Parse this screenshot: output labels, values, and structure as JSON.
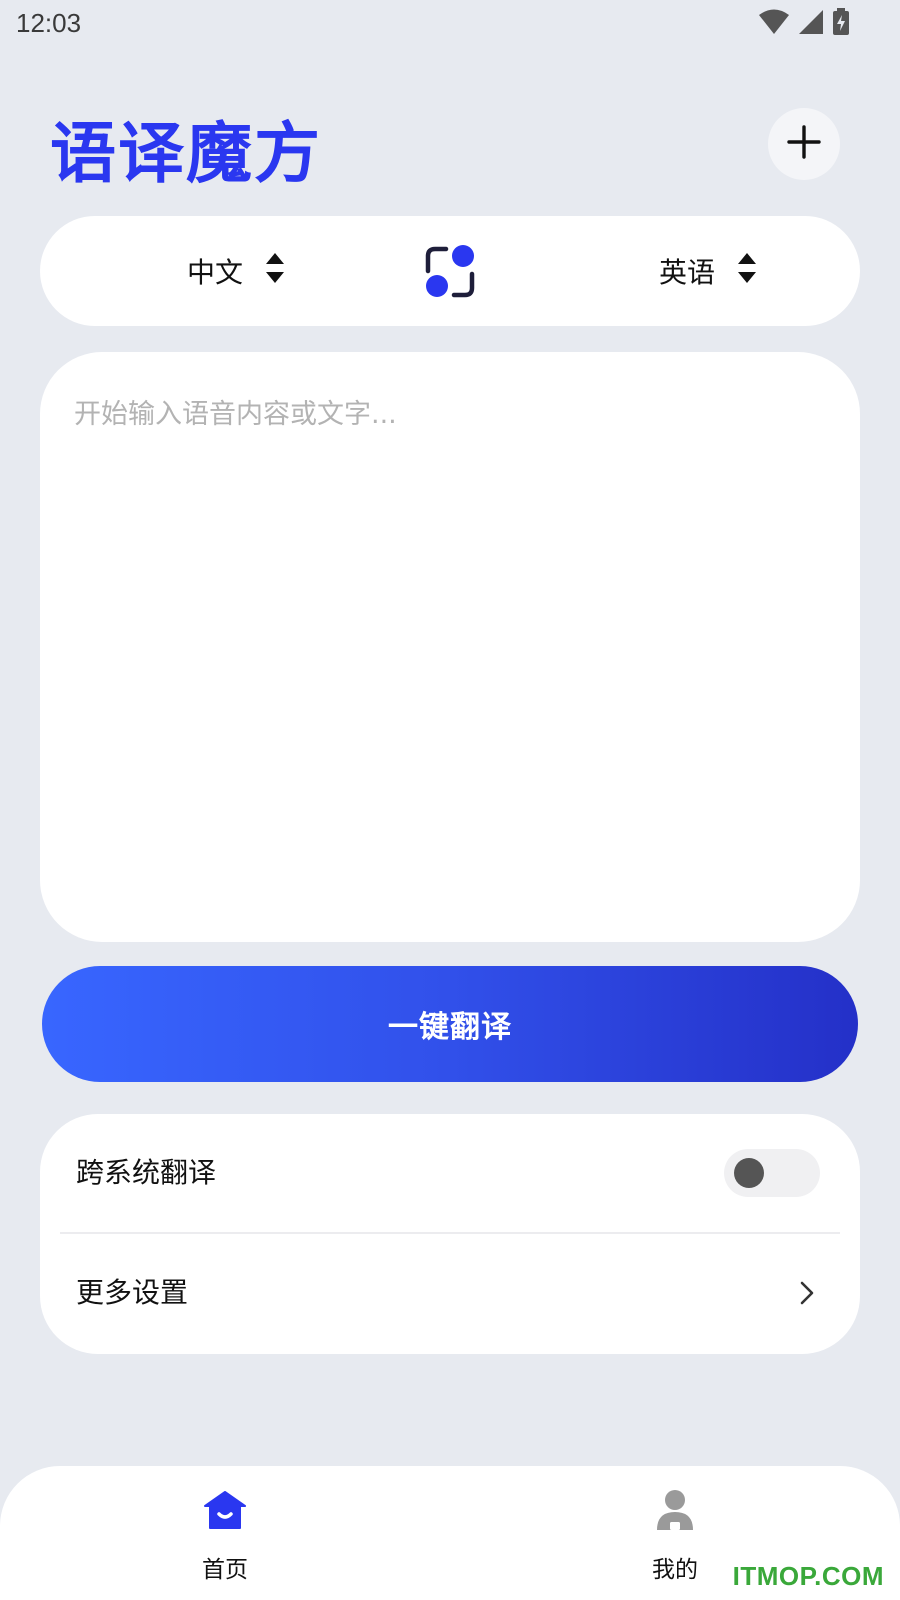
{
  "status_bar": {
    "time": "12:03",
    "icons": [
      "wifi-icon",
      "signal-icon",
      "battery-charging-icon"
    ]
  },
  "header": {
    "title": "语译魔方",
    "add_icon": "plus-icon"
  },
  "language_bar": {
    "source_language": "中文",
    "target_language": "英语",
    "swap_icon": "swap-languages-icon"
  },
  "input": {
    "value": "",
    "placeholder": "开始输入语音内容或文字..."
  },
  "actions": {
    "translate_label": "一键翻译"
  },
  "settings": {
    "items": [
      {
        "label": "跨系统翻译",
        "control": "toggle",
        "enabled": false
      },
      {
        "label": "更多设置",
        "control": "chevron-right-icon"
      }
    ]
  },
  "bottom_nav": {
    "items": [
      {
        "label": "首页",
        "icon": "home-icon",
        "active": true
      },
      {
        "label": "我的",
        "icon": "user-icon",
        "active": false
      }
    ]
  },
  "watermark": "ITMOP.COM",
  "colors": {
    "brand": "#2a37f0",
    "background": "#e7eaf0",
    "button_gradient_start": "#3866ff",
    "button_gradient_end": "#2430c8",
    "nav_active": "#2a37f0",
    "nav_inactive": "#9a9a9a",
    "watermark": "#3aa83a"
  }
}
